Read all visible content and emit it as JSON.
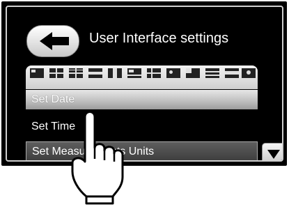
{
  "header": {
    "title": "User Interface settings"
  },
  "menu": {
    "items": [
      {
        "label": "Set Date"
      },
      {
        "label": "Set Time"
      },
      {
        "label": "Set Measurements Units"
      }
    ]
  },
  "icons": {
    "back": "back-arrow-icon",
    "scroll": "chevron-down-icon",
    "pointer": "pointing-hand-icon"
  },
  "colors": {
    "background": "#000000",
    "row_highlight": "#bdbdbd",
    "text": "#ffffff"
  }
}
